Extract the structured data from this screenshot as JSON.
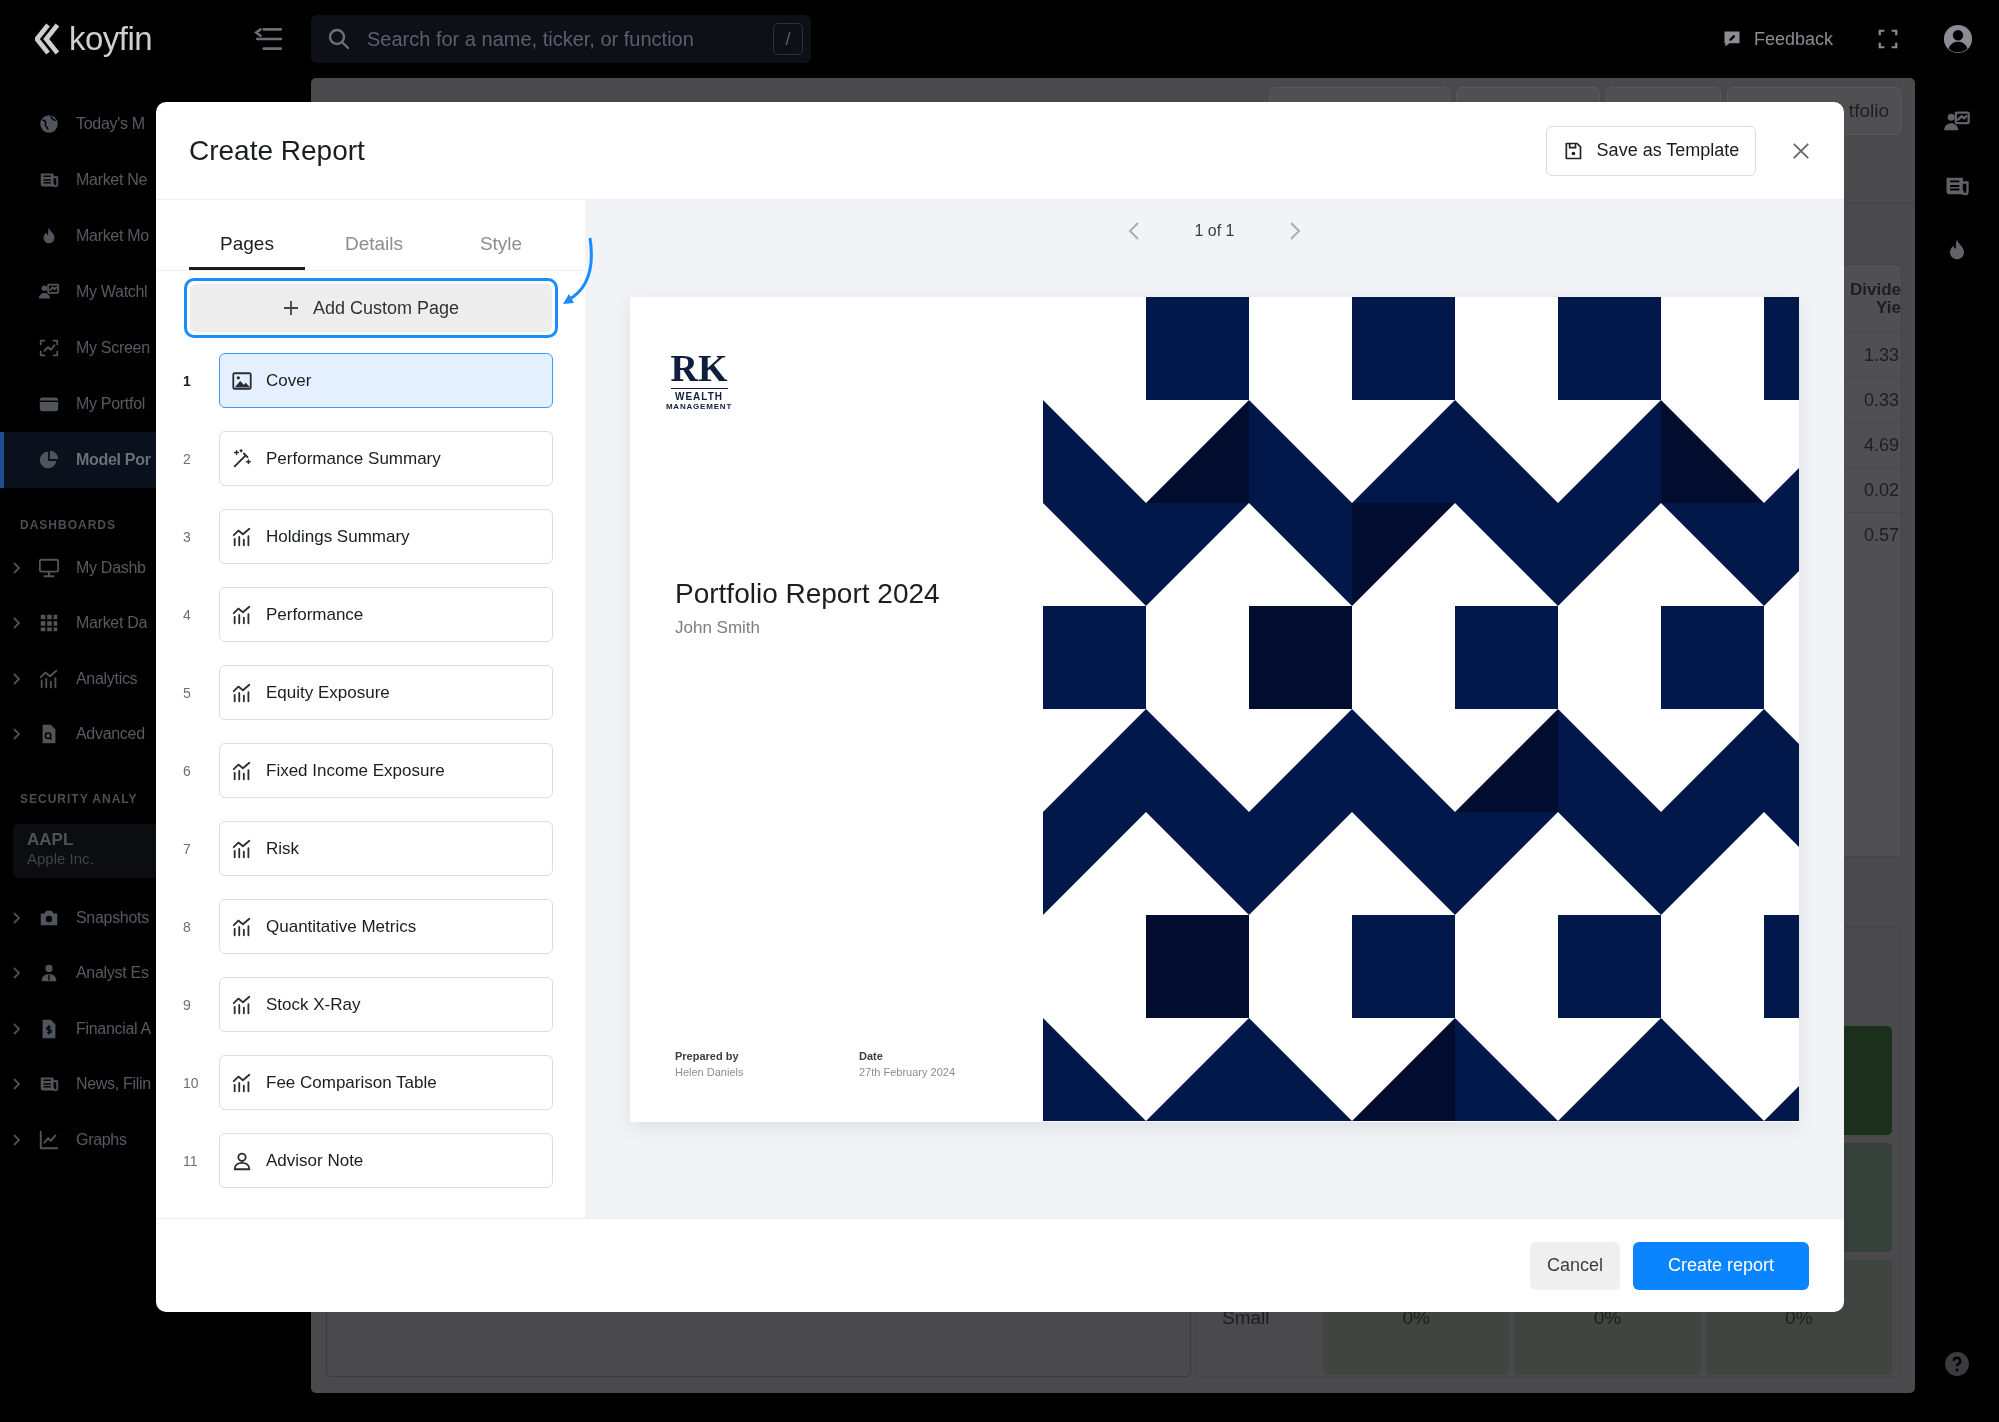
{
  "topbar": {
    "logo": "koyfin",
    "search": {
      "placeholder": "Search for a name, ticker, or function",
      "shortcut": "/"
    },
    "feedback": "Feedback"
  },
  "sidebar": {
    "nav": [
      {
        "label": "Today's M",
        "selected": false
      },
      {
        "label": "Market Ne",
        "selected": false
      },
      {
        "label": "Market Mo",
        "selected": false
      },
      {
        "label": "My Watchl",
        "selected": false
      },
      {
        "label": "My Screen",
        "selected": false
      },
      {
        "label": "My Portfol",
        "selected": false
      },
      {
        "label": "Model Por",
        "selected": true
      }
    ],
    "sections": [
      {
        "heading": "DASHBOARDS",
        "items": [
          {
            "label": "My Dashb",
            "expanded": false
          },
          {
            "label": "Market Da",
            "expanded": false
          },
          {
            "label": "Analytics",
            "expanded": false
          },
          {
            "label": "Advanced",
            "expanded": false
          }
        ]
      },
      {
        "heading": "SECURITY ANALY",
        "security": {
          "ticker": "AAPL",
          "name": "Apple Inc."
        },
        "items": [
          {
            "label": "Snapshots",
            "expanded": false
          },
          {
            "label": "Analyst Es",
            "expanded": false
          },
          {
            "label": "Financial A",
            "expanded": false
          },
          {
            "label": "News, Filin",
            "expanded": false
          },
          {
            "label": "Graphs",
            "expanded": false
          }
        ]
      }
    ]
  },
  "backdrop": {
    "tab": "tfolio",
    "dividend_table": {
      "heading": [
        "Divide",
        "Yie"
      ],
      "values": [
        "1.33",
        "0.33",
        "4.69",
        "0.02",
        "0.57"
      ]
    },
    "allocation_row": {
      "label": "Small",
      "cells": [
        "0%",
        "0%",
        "0%"
      ]
    }
  },
  "dialog": {
    "title": "Create Report",
    "save_template": "Save as Template",
    "tabs": [
      {
        "label": "Pages",
        "selected": true
      },
      {
        "label": "Details",
        "selected": false
      },
      {
        "label": "Style",
        "selected": false
      }
    ],
    "add_page": "Add Custom Page",
    "pages": [
      {
        "number": "1",
        "label": "Cover",
        "selected": true
      },
      {
        "number": "2",
        "label": "Performance Summary",
        "selected": false
      },
      {
        "number": "3",
        "label": "Holdings Summary",
        "selected": false
      },
      {
        "number": "4",
        "label": "Performance",
        "selected": false
      },
      {
        "number": "5",
        "label": "Equity Exposure",
        "selected": false
      },
      {
        "number": "6",
        "label": "Fixed Income Exposure",
        "selected": false
      },
      {
        "number": "7",
        "label": "Risk",
        "selected": false
      },
      {
        "number": "8",
        "label": "Quantitative Metrics",
        "selected": false
      },
      {
        "number": "9",
        "label": "Stock X-Ray",
        "selected": false
      },
      {
        "number": "10",
        "label": "Fee Comparison Table",
        "selected": false
      },
      {
        "number": "11",
        "label": "Advisor Note",
        "selected": false
      }
    ],
    "pager": "1 of 1",
    "cover": {
      "logo": {
        "mark": "RK",
        "line1": "WEALTH",
        "line2": "MANAGEMENT"
      },
      "title": "Portfolio Report 2024",
      "client": "John Smith",
      "prepared_by": {
        "label": "Prepared by",
        "value": "Helen Daniels"
      },
      "date": {
        "label": "Date",
        "value": "27th February 2024"
      }
    },
    "buttons": {
      "cancel": "Cancel",
      "create": "Create report"
    }
  }
}
